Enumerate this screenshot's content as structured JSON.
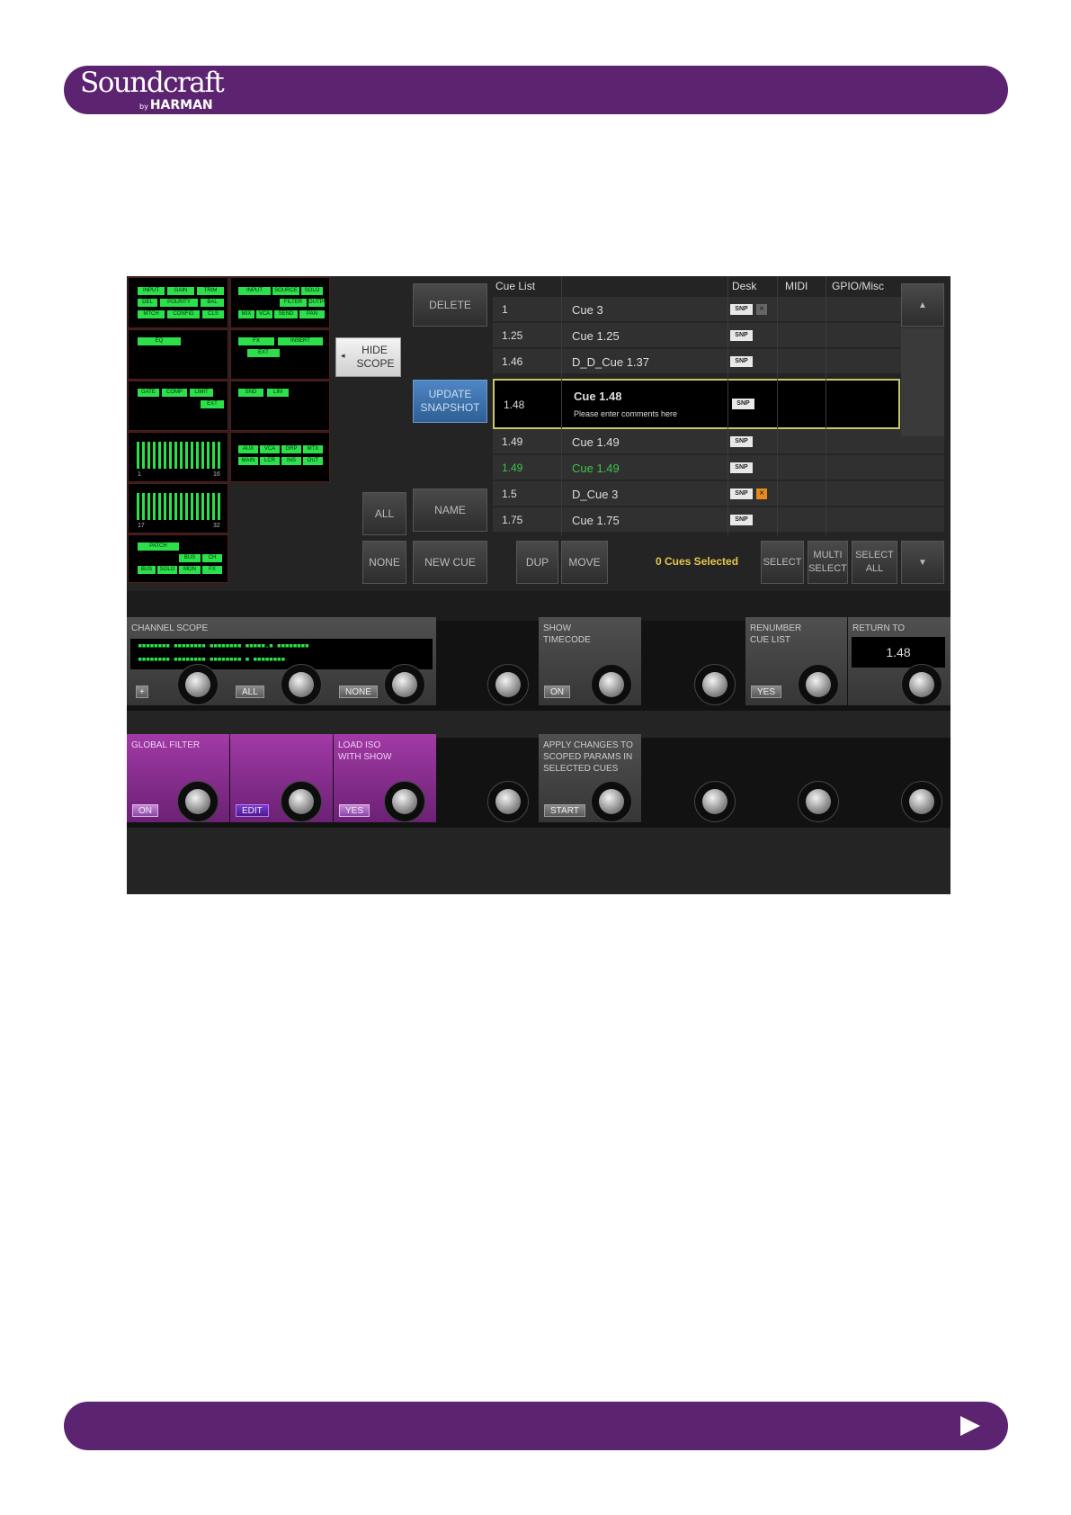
{
  "header": {
    "brand": "Soundcraft",
    "by": "by",
    "manufacturer": "HARMAN"
  },
  "scope_grid": {
    "row1": [
      "INPUT",
      "GAIN",
      "TRIM",
      "DEL",
      "POLRITY",
      "BAL",
      "MTCH",
      "CONFIG",
      "CLS"
    ],
    "row1b": [
      "INPUT",
      "SOURCE",
      "SOLO",
      "FILTER",
      "OUTPUT",
      "MIX",
      "VCA",
      "SEND",
      "PAN"
    ],
    "eq": "EQ",
    "fx1": [
      "FX",
      "INSERT",
      "EXT"
    ],
    "dyn": [
      "GATE",
      "COMP",
      "LIMIT",
      "EXT"
    ],
    "snd": [
      "SND",
      "LIM"
    ],
    "aux": [
      "AUX",
      "VCA",
      "GRP",
      "MTX",
      "MAIN",
      "LCR",
      "INS",
      "OUT"
    ],
    "range1": [
      "1",
      "16"
    ],
    "range2": [
      "17",
      "32"
    ],
    "misc": [
      "PATCH",
      "BUS",
      "CH",
      "BUS",
      "SOLO",
      "MON",
      "FX"
    ],
    "bar_count": 16
  },
  "buttons": {
    "hide_scope": "HIDE SCOPE",
    "delete": "DELETE",
    "update_snapshot": "UPDATE SNAPSHOT",
    "all": "ALL",
    "name": "NAME",
    "none": "NONE",
    "new_cue": "NEW CUE",
    "dup": "DUP",
    "move": "MOVE",
    "select": "SELECT",
    "multi_select": "MULTI SELECT",
    "select_all": "SELECT ALL",
    "scroll_up": "▲",
    "scroll_down": "▼"
  },
  "cue_list": {
    "headers": [
      "Cue List",
      "Desk",
      "MIDI",
      "GPIO/Misc"
    ],
    "rows": [
      {
        "num": "1",
        "name": "Cue 3",
        "snp": "SNP",
        "mark": "×"
      },
      {
        "num": "1.25",
        "name": "Cue 1.25",
        "snp": "SNP",
        "mark": ""
      },
      {
        "num": "1.46",
        "name": "D_D_Cue 1.37",
        "snp": "SNP",
        "mark": ""
      },
      {
        "num": "1.48",
        "name": "Cue 1.48",
        "comment": "Please enter comments here",
        "snp": "SNP",
        "mark": ""
      },
      {
        "num": "1.49",
        "name": "Cue 1.49",
        "snp": "SNP",
        "mark": ""
      },
      {
        "num": "1.49",
        "name": "Cue 1.49",
        "snp": "SNP",
        "mark": ""
      },
      {
        "num": "1.5",
        "name": "D_Cue 3",
        "snp": "SNP",
        "mark": "×"
      },
      {
        "num": "1.75",
        "name": "Cue 1.75",
        "snp": "SNP",
        "mark": ""
      }
    ],
    "selected_status": "0 Cues Selected"
  },
  "strip1": {
    "channel_scope": "CHANNEL SCOPE",
    "scope_plus": "+",
    "scope_all": "ALL",
    "scope_none": "NONE",
    "show_timecode": "SHOW TIMECODE",
    "timecode_on": "ON",
    "renumber": "RENUMBER CUE LIST",
    "renumber_yes": "YES",
    "return_to": "RETURN TO",
    "return_value": "1.48",
    "led_line1": "▪▪▪▪▪▪▪▪ ▪▪▪▪▪▪▪▪ ▪▪▪▪▪▪▪▪ ▪▪▪▪▪.▪ ▪▪▪▪▪▪▪▪",
    "led_line2": "▪▪▪▪▪▪▪▪ ▪▪▪▪▪▪▪▪ ▪▪▪▪▪▪▪▪        ▪ ▪▪▪▪▪▪▪▪"
  },
  "strip2": {
    "global_filter": "GLOBAL FILTER",
    "global_on": "ON",
    "edit": "EDIT",
    "load_iso": "LOAD ISO WITH SHOW",
    "load_yes": "YES",
    "apply_changes": "APPLY CHANGES TO SCOPED PARAMS IN SELECTED CUES",
    "apply_start": "START"
  }
}
